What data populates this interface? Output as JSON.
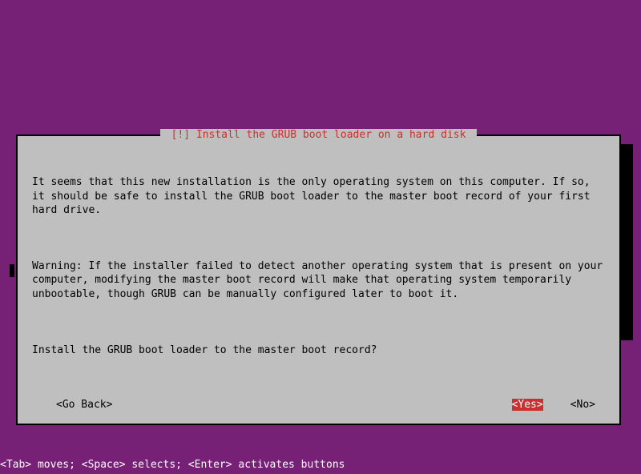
{
  "dialog": {
    "title_prefix": "[!]",
    "title": "Install the GRUB boot loader on a hard disk",
    "p1": "It seems that this new installation is the only operating system on this computer. If so, it should be safe to install the GRUB boot loader to the master boot record of your first hard drive.",
    "p2": "Warning: If the installer failed to detect another operating system that is present on your computer, modifying the master boot record will make that operating system temporarily unbootable, though GRUB can be manually configured later to boot it.",
    "p3": "Install the GRUB boot loader to the master boot record?",
    "go_back": "<Go Back>",
    "yes": "<Yes>",
    "no": "<No>"
  },
  "hint": "<Tab> moves; <Space> selects; <Enter> activates buttons"
}
